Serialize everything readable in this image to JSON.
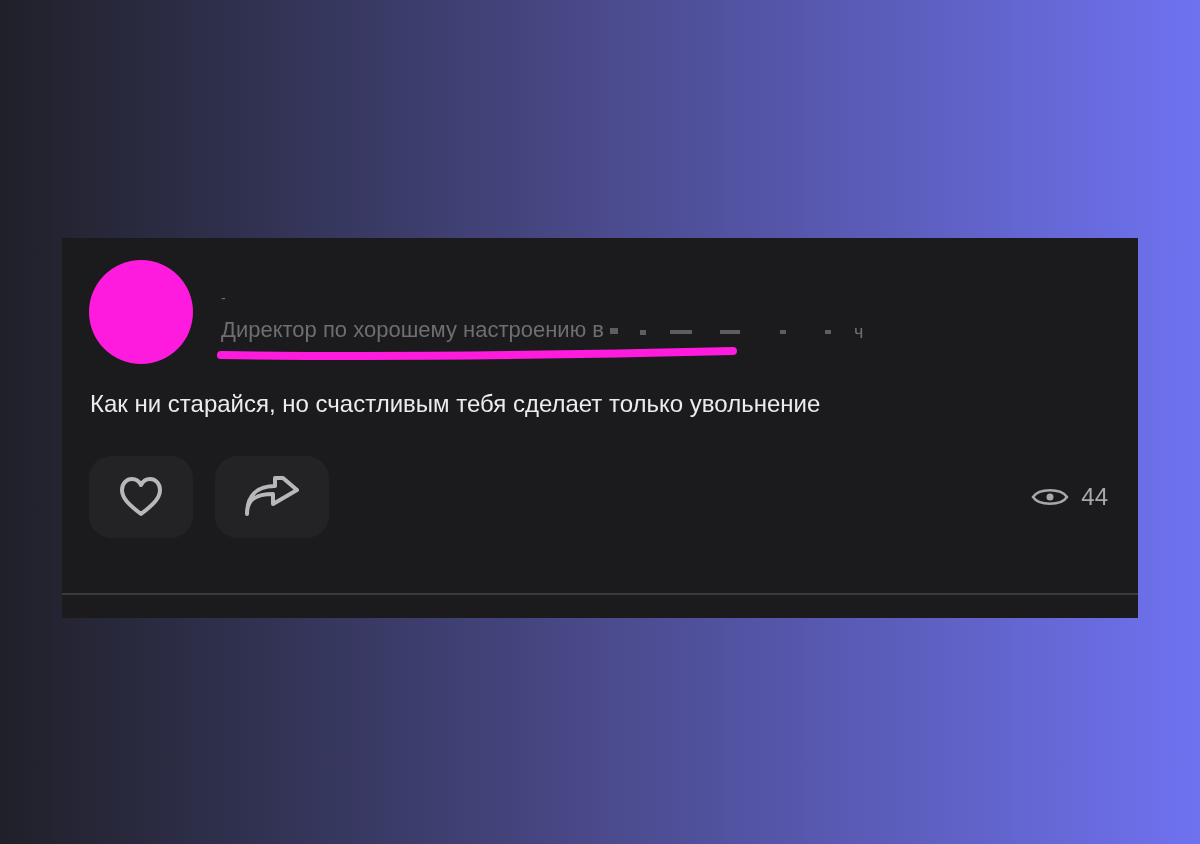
{
  "post": {
    "author_name": "-",
    "author_subtitle": "Директор по хорошему настроению в",
    "subtitle_tail": "ч",
    "text": "Как ни старайся, но счастливым тебя сделает только увольнение",
    "liked": false,
    "views": "44"
  }
}
